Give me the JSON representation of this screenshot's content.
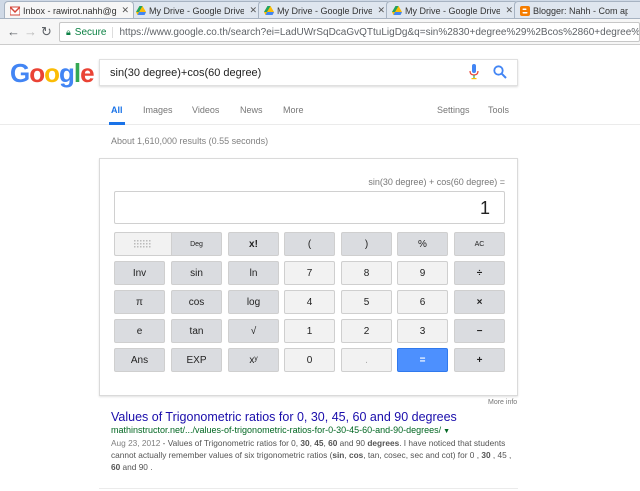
{
  "tabs": [
    {
      "label": "Inbox - rawirot.nahh@g",
      "icon": "gmail-icon"
    },
    {
      "label": "My Drive - Google Drive",
      "icon": "drive-icon"
    },
    {
      "label": "My Drive - Google Drive",
      "icon": "drive-icon"
    },
    {
      "label": "My Drive - Google Drive",
      "icon": "drive-icon"
    },
    {
      "label": "Blogger: Nahh - Com ap",
      "icon": "blogger-icon"
    }
  ],
  "address_bar": {
    "secure_label": "Secure",
    "url": "https://www.google.co.th/search?ei=LadUWrSqDcaGvQTtuLigDg&q=sin%2830+degree%29%2Bcos%2860+degree%29&oq=sin"
  },
  "search": {
    "logo": [
      "G",
      "o",
      "o",
      "g",
      "l",
      "e"
    ],
    "query": "sin(30 degree)+cos(60 degree)"
  },
  "nav": {
    "all": "All",
    "images": "Images",
    "videos": "Videos",
    "news": "News",
    "more": "More",
    "settings": "Settings",
    "tools": "Tools"
  },
  "stats": "About 1,610,000 results (0.55 seconds)",
  "calculator": {
    "expression": "sin(30 degree) + cos(60 degree) =",
    "result": "1",
    "keys": {
      "deg": "Deg",
      "fact": "x!",
      "lparen": "(",
      "rparen": ")",
      "percent": "%",
      "ac": "AC",
      "inv": "Inv",
      "sin": "sin",
      "ln": "ln",
      "seven": "7",
      "eight": "8",
      "nine": "9",
      "divide": "÷",
      "pi": "π",
      "cos": "cos",
      "log": "log",
      "four": "4",
      "five": "5",
      "six": "6",
      "multiply": "×",
      "e": "e",
      "tan": "tan",
      "sqrt": "√",
      "one": "1",
      "two": "2",
      "three": "3",
      "minus": "−",
      "ans": "Ans",
      "exp": "EXP",
      "power": "xʸ",
      "zero": "0",
      "dot": ".",
      "equals": "=",
      "plus": "+"
    },
    "more_info": "More info"
  },
  "result": {
    "title": "Values of Trigonometric ratios for 0, 30, 45, 60 and 90 degrees",
    "url": "mathinstructor.net/.../values-of-trigonometric-ratios-for-0-30-45-60-and-90-degrees/",
    "date": "Aug 23, 2012",
    "snippet_parts": [
      " - Values of Trigonometric ratios for 0, ",
      "30",
      ", ",
      "45",
      ", ",
      "60",
      " and 90 ",
      "degrees",
      ". I have noticed that students cannot actually remember values of six trigonometric ratios (",
      "sin",
      ", ",
      "cos",
      ", tan, cosec, sec and cot) for 0 , ",
      "30",
      " , 45 , ",
      "60",
      " and 90 ."
    ]
  },
  "colors": {
    "link": "#1a0dab",
    "url_green": "#006621",
    "accent_blue": "#4d90fe",
    "secure_green": "#0b8043"
  }
}
